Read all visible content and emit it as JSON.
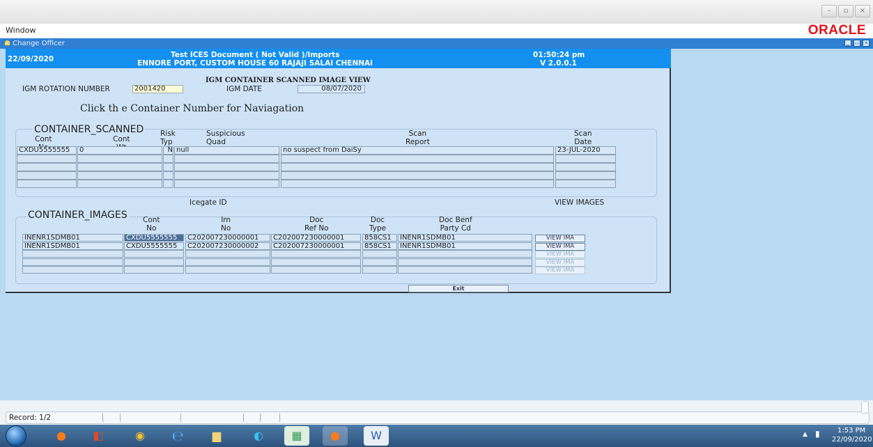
{
  "menu": {
    "window": "Window",
    "brand": "ORACLE"
  },
  "window_controls": {
    "min": "–",
    "max": "▫",
    "close": "×"
  },
  "mdi": {
    "title": "Change Officer"
  },
  "header": {
    "date": "22/09/2020",
    "line1": "Test ICES Document ( Not Valid )/Imports",
    "line2": "ENNORE PORT, CUSTOM HOUSE 60 RAJAJI SALAI CHENNAI",
    "time": "01:50:24 pm",
    "version": "V 2.0.0.1"
  },
  "form": {
    "rotation_label": "IGM ROTATION NUMBER",
    "rotation_value": "2001420",
    "title": "IGM CONTAINER  SCANNED IMAGE VIEW",
    "igm_date_label": "IGM DATE",
    "igm_date_value": "08/07/2020",
    "nav_hint": "Click th e Container Number  for Naviagation"
  },
  "scanned": {
    "section": "CONTAINER_SCANNED",
    "headers": {
      "cont_no": "Cont\nNo",
      "cont_wt": "Cont\nWt",
      "risk": "Risk\nTyp",
      "quad": "Suspicious\nQuad",
      "report": "Scan\nReport",
      "date": "Scan\nDate"
    },
    "rows": [
      {
        "cont_no": "CXDU5555555",
        "cont_wt": "0",
        "risk": "N",
        "quad": "null",
        "report": "no suspect from DaiSy",
        "date": "23-JUL-2020"
      }
    ]
  },
  "images": {
    "icegate_label": "Icegate ID",
    "view_images_label": "VIEW IMAGES",
    "section": "CONTAINER_IMAGES",
    "headers": {
      "cont_no": "Cont\nNo",
      "irn": "Irn\nNo",
      "doc_ref": "Doc\nRef No",
      "doc_type": "Doc\nType",
      "party": "Doc Benf\nParty Cd"
    },
    "rows": [
      {
        "icegate": "INENR1SDMB01",
        "cont_no": "CXDU5555555",
        "irn": "C202007230000001",
        "doc_ref": "C202007230000001",
        "doc_type": "858CS1",
        "party": "INENR1SDMB01",
        "view": "VIEW IMA"
      },
      {
        "icegate": "INENR1SDMB01",
        "cont_no": "CXDU5555555",
        "irn": "C202007230000002",
        "doc_ref": "C202007230000001",
        "doc_type": "858CS1",
        "party": "INENR1SDMB01",
        "view": "VIEW IMA"
      }
    ],
    "empty_view": "VIEW IMA",
    "exit": "Exit"
  },
  "status": {
    "record": "Record: 1/2"
  },
  "taskbar": {
    "time": "1:53 PM",
    "date": "22/09/2020"
  },
  "colors": {
    "header_blue": "#138ff0",
    "mdi_bg": "#b9d9f3",
    "form_bg": "#cfe3f7",
    "oracle_red": "#e8101c"
  }
}
